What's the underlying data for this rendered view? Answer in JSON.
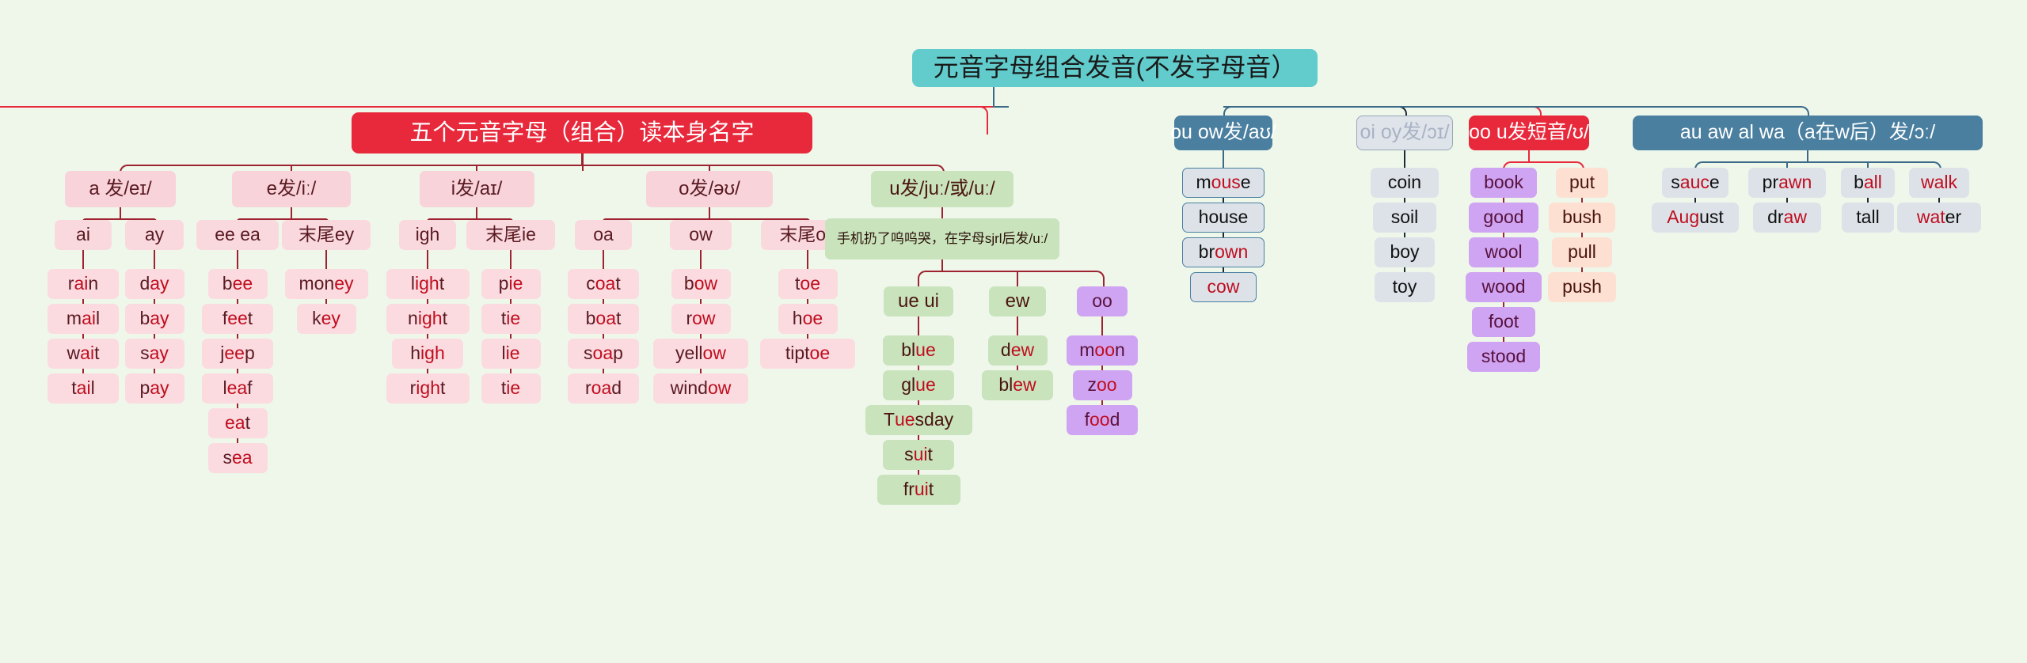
{
  "title": "元音字母组合发音(不发字母音）",
  "colors": {
    "background": "#eef7ea",
    "root": "#62cccc",
    "red_header": "#e8293b",
    "blue_header": "#4a7fa0",
    "grey_header": "#dfe3ea",
    "pink": "#f8d3da",
    "green": "#c9e3bd",
    "purple": "#cfa4f2",
    "peach": "#fde0d2",
    "grey": "#dde2e9",
    "highlight_letter": "#c00d1e",
    "connector_red": "#9e2230",
    "connector_blue": "#3b6a88"
  },
  "branches": {
    "main_red": {
      "label": "五个元音字母（组合）读本身名字",
      "groups": [
        {
          "label": "a 发/eɪ/",
          "columns": [
            {
              "label": "ai",
              "words": [
                "rain",
                "mail",
                "wait",
                "tail"
              ]
            },
            {
              "label": "ay",
              "words": [
                "day",
                "bay",
                "say",
                "pay"
              ]
            }
          ]
        },
        {
          "label": "e发/iː/",
          "columns": [
            {
              "label": "ee ea",
              "words": [
                "bee",
                "feet",
                "jeep",
                "leaf",
                "eat",
                "sea"
              ]
            },
            {
              "label": "末尾ey",
              "words": [
                "money",
                "key"
              ]
            }
          ]
        },
        {
          "label": "i发/aɪ/",
          "columns": [
            {
              "label": "igh",
              "words": [
                "light",
                "night",
                "high",
                "right"
              ]
            },
            {
              "label": "末尾ie",
              "words": [
                "pie",
                "tie",
                "lie",
                "tie"
              ]
            }
          ]
        },
        {
          "label": "o发/əʊ/",
          "columns": [
            {
              "label": "oa",
              "words": [
                "coat",
                "boat",
                "soap",
                "road"
              ]
            },
            {
              "label": "ow",
              "words": [
                "bow",
                "row",
                "yellow",
                "window"
              ]
            },
            {
              "label": "末尾oe",
              "words": [
                "toe",
                "hoe",
                "tiptoe"
              ]
            }
          ]
        }
      ]
    },
    "u_green": {
      "label": "u发/juː/或/uː/",
      "note": "手机扔了呜呜哭，在字母sjrl后发/uː/",
      "columns": [
        {
          "label": "ue ui",
          "words": [
            "blue",
            "glue",
            "Tuesday",
            "suit",
            "fruit"
          ]
        },
        {
          "label": "ew",
          "words": [
            "dew",
            "blew"
          ]
        },
        {
          "label": "oo",
          "words": [
            "moon",
            "zoo",
            "food"
          ]
        }
      ]
    },
    "ou_ow": {
      "label": "ou ow发/aʊ/",
      "words": [
        "mouse",
        "house",
        "brown",
        "cow"
      ]
    },
    "oi_oy": {
      "label": "oi oy发/ɔɪ/",
      "words": [
        "coin",
        "soil",
        "boy",
        "toy"
      ]
    },
    "oo_u_short": {
      "label": "oo u发短音/ʊ/",
      "columns": [
        {
          "words": [
            "book",
            "good",
            "wool",
            "wood",
            "foot",
            "stood"
          ]
        },
        {
          "words": [
            "put",
            "bush",
            "pull",
            "push"
          ]
        }
      ]
    },
    "au_aw_al_wa": {
      "label": "au aw al wa（a在w后）发/ɔː/",
      "columns": [
        {
          "words": [
            "sauce",
            "August"
          ]
        },
        {
          "words": [
            "prawn",
            "draw"
          ]
        },
        {
          "words": [
            "ball",
            "tall"
          ]
        },
        {
          "words": [
            "walk",
            "water"
          ]
        }
      ]
    }
  }
}
